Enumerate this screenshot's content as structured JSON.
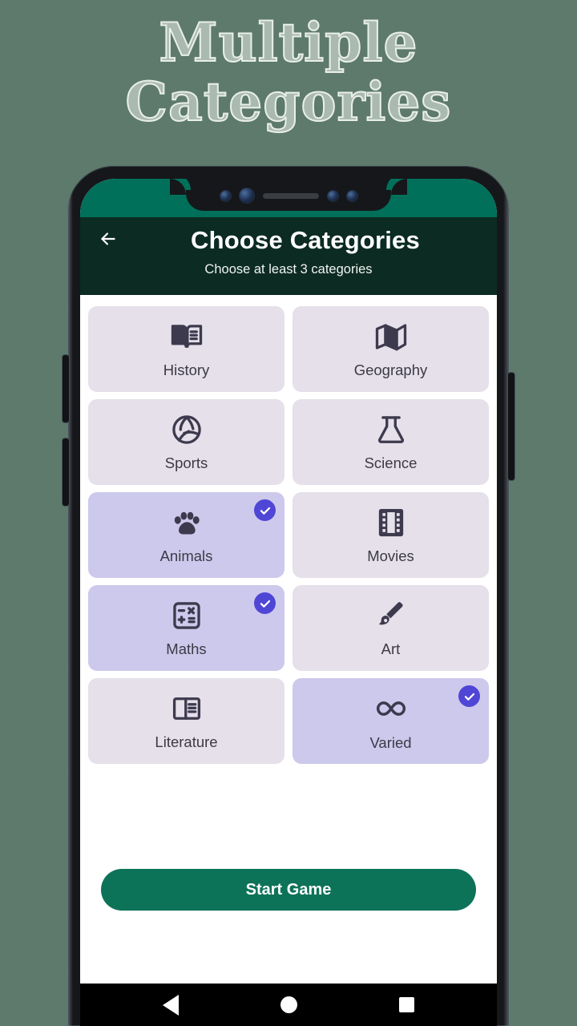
{
  "promo": {
    "line1": "Multiple",
    "line2": "Categories"
  },
  "colors": {
    "page_background": "#5d7a6c",
    "status_bar": "#00705a",
    "app_bar": "#0c2b22",
    "card_unselected": "#e5e0ea",
    "card_selected": "#cdc9ec",
    "check_badge": "#4f46d6",
    "cta_button": "#0d7358",
    "icon": "#3d3a4e"
  },
  "app_bar": {
    "back_icon": "arrow-left-icon",
    "title": "Choose Categories",
    "subtitle": "Choose at least 3 categories"
  },
  "categories": [
    {
      "label": "History",
      "icon": "open-book-icon",
      "selected": false
    },
    {
      "label": "Geography",
      "icon": "folded-map-icon",
      "selected": false
    },
    {
      "label": "Sports",
      "icon": "volleyball-icon",
      "selected": false
    },
    {
      "label": "Science",
      "icon": "flask-icon",
      "selected": false
    },
    {
      "label": "Animals",
      "icon": "paw-print-icon",
      "selected": true
    },
    {
      "label": "Movies",
      "icon": "film-strip-icon",
      "selected": false
    },
    {
      "label": "Maths",
      "icon": "calculator-icon",
      "selected": true
    },
    {
      "label": "Art",
      "icon": "paint-brush-icon",
      "selected": false
    },
    {
      "label": "Literature",
      "icon": "article-book-icon",
      "selected": false
    },
    {
      "label": "Varied",
      "icon": "infinity-icon",
      "selected": true
    }
  ],
  "cta": {
    "label": "Start Game"
  },
  "nav_bar": {
    "back": "back-triangle-icon",
    "home": "home-circle-icon",
    "recents": "recents-square-icon"
  }
}
